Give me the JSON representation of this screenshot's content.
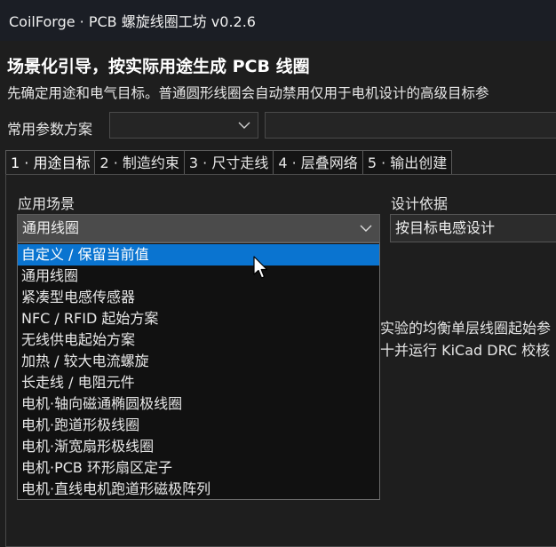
{
  "window": {
    "title": "CoilForge · PCB 螺旋线圈工坊 v0.2.6"
  },
  "header": {
    "heading": "场景化引导，按实际用途生成 PCB 线圈",
    "subtitle": "先确定用途和电气目标。普通圆形线圈会自动禁用仅用于电机设计的高级目标参"
  },
  "preset": {
    "label": "常用参数方案",
    "selected": "",
    "name_value": ""
  },
  "tabs": [
    {
      "label": "1 · 用途目标",
      "active": true
    },
    {
      "label": "2 · 制造约束",
      "active": false
    },
    {
      "label": "3 · 尺寸走线",
      "active": false
    },
    {
      "label": "4 · 层叠网络",
      "active": false
    },
    {
      "label": "5 · 输出创建",
      "active": false
    }
  ],
  "usage": {
    "scene_label": "应用场景",
    "scene_value": "通用线圈",
    "basis_label": "设计依据",
    "basis_value": "按目标电感设计",
    "background_lines": [
      "实验的均衡单层线圈起始参",
      "十并运行 KiCad DRC 校核"
    ],
    "scene_options": [
      "自定义 / 保留当前值",
      "通用线圈",
      "紧凑型电感传感器",
      "NFC / RFID 起始方案",
      "无线供电起始方案",
      "加热 / 较大电流螺旋",
      "长走线 / 电阻元件",
      "电机·轴向磁通椭圆极线圈",
      "电机·跑道形极线圈",
      "电机·渐宽扇形极线圈",
      "电机·PCB 环形扇区定子",
      "电机·直线电机跑道形磁极阵列"
    ],
    "highlighted_option": "自定义 / 保留当前值"
  },
  "icons": {
    "combo_arrow": "chevron-down-icon",
    "pointer": "mouse-cursor-icon"
  },
  "colors": {
    "highlight": "#0a74d0",
    "background": "#1e1e1e",
    "titlebar": "#1b1e25"
  }
}
